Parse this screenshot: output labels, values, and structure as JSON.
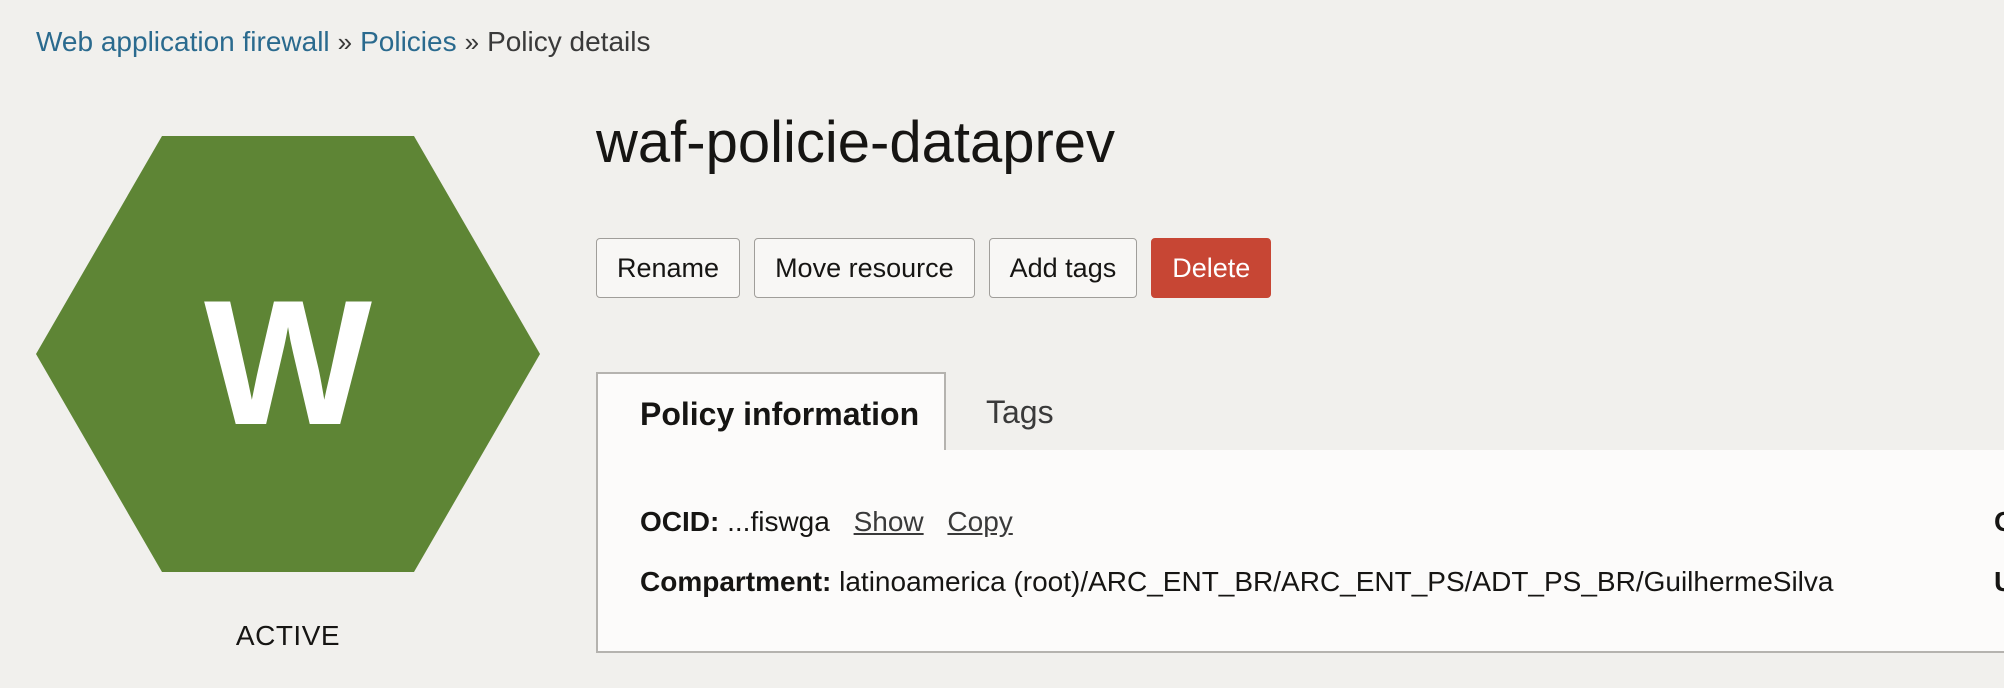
{
  "breadcrumb": {
    "items": [
      "Web application firewall",
      "Policies"
    ],
    "separator": "»",
    "current": "Policy details"
  },
  "resource_icon": {
    "letter": "W",
    "color": "#5e8535",
    "status": "ACTIVE"
  },
  "page": {
    "title": "waf-policie-dataprev"
  },
  "actions": {
    "rename": "Rename",
    "move": "Move resource",
    "add_tags": "Add tags",
    "delete": "Delete",
    "delete_color": "#c74634"
  },
  "tabs": [
    {
      "label": "Policy information",
      "active": true
    },
    {
      "label": "Tags",
      "active": false
    }
  ],
  "info": {
    "ocid_label": "OCID:",
    "ocid_value": "...fiswga",
    "ocid_show": "Show",
    "ocid_copy": "Copy",
    "compartment_label": "Compartment:",
    "compartment_value": "latinoamerica (root)/ARC_ENT_BR/ARC_ENT_PS/ADT_PS_BR/GuilhermeSilva",
    "right_col_cut_1": "C",
    "right_col_cut_2": "U"
  }
}
